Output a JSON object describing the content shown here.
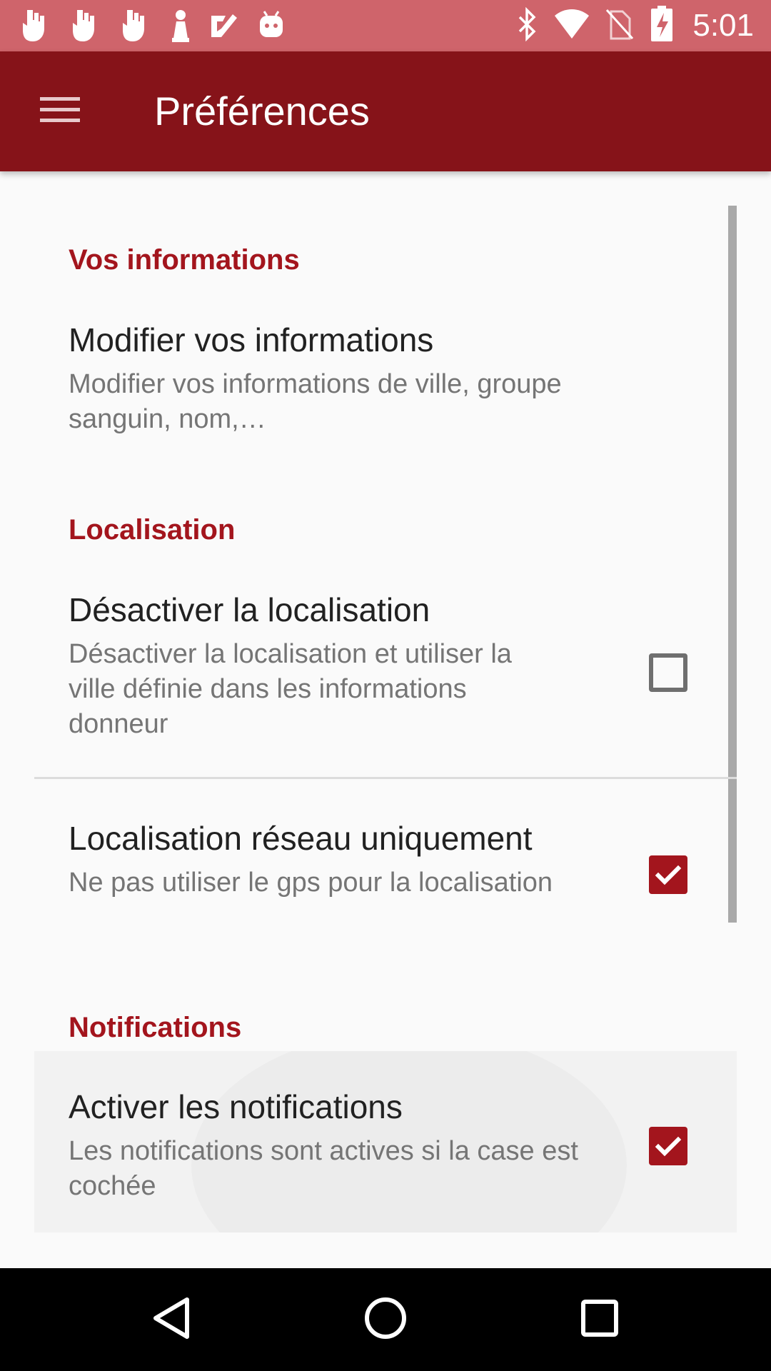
{
  "status_bar": {
    "time": "5:01",
    "notification_icons": [
      "hand-icon",
      "hand-icon",
      "hand-icon",
      "chess-pawn-icon",
      "checkmark-icon",
      "android-icon"
    ],
    "system_icons": [
      "bluetooth-icon",
      "wifi-icon",
      "no-sim-icon",
      "battery-charging-icon"
    ],
    "background_color": "#cf646b"
  },
  "app_bar": {
    "title": "Préférences",
    "menu_icon": "hamburger-menu-icon",
    "background_color": "#861319"
  },
  "sections": [
    {
      "header": "Vos informations",
      "items": [
        {
          "title": "Modifier vos informations",
          "summary": "Modifier vos informations de ville, groupe sanguin, nom,…"
        }
      ]
    },
    {
      "header": "Localisation",
      "items": [
        {
          "title": "Désactiver la localisation",
          "summary": "Désactiver la localisation et utiliser la ville définie dans les informations donneur",
          "checked": false
        },
        {
          "title": "Localisation réseau uniquement",
          "summary": "Ne pas utiliser le gps pour la localisation",
          "checked": true
        }
      ]
    },
    {
      "header": "Notifications",
      "items": [
        {
          "title": "Activer les notifications",
          "summary": "Les notifications sont actives si la case est cochée",
          "checked": true
        }
      ]
    }
  ],
  "accent_color": "#a3151d",
  "navigation_bar": {
    "buttons": [
      "back-icon",
      "home-icon",
      "recents-icon"
    ]
  }
}
